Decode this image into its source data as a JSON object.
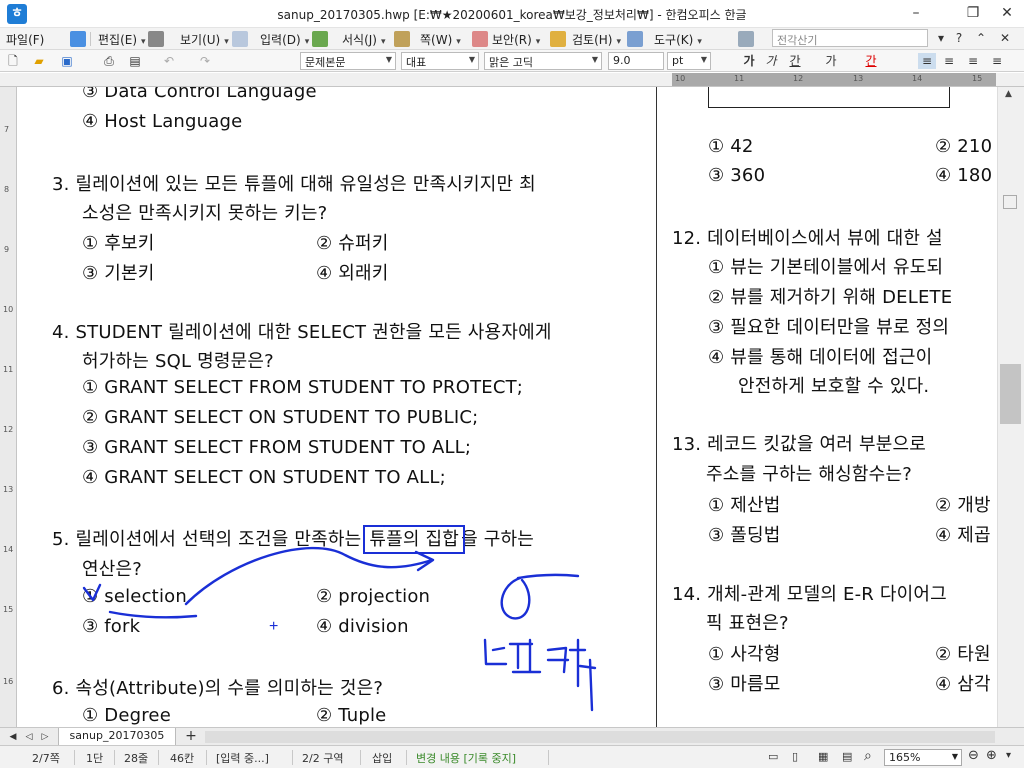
{
  "window": {
    "title": "sanup_20170305.hwp [E:₩★20200601_korea₩보강_정보처리₩] - 한컴오피스 한글",
    "minimize": "–",
    "maximize": "❐",
    "close": "✕"
  },
  "menu": {
    "items": [
      "파일(F)",
      "편집(E)",
      "보기(U)",
      "입력(D)",
      "서식(J)",
      "쪽(W)",
      "보안(R)",
      "검토(H)",
      "도구(K)"
    ],
    "search_placeholder": "전각산기"
  },
  "toolbar": {
    "style": "문제본문",
    "shape": "대표",
    "font": "맑은 고딕",
    "size": "9.0",
    "unit": "pt",
    "bold": "가",
    "italic": "가",
    "underline": "간",
    "strike": "가",
    "color": "간"
  },
  "ruler": {
    "h_numbers": [
      "10",
      "11",
      "12",
      "13",
      "14",
      "15"
    ],
    "v_numbers": [
      "7",
      "8",
      "9",
      "10",
      "11",
      "12",
      "13",
      "14",
      "15",
      "16"
    ]
  },
  "left_column": {
    "partial_top": "③  Data  Control  Language",
    "q2_opt4": "④  Host  Language",
    "q3_line1": "3.  릴레이션에  있는  모든  튜플에  대해  유일성은  만족시키지만  최",
    "q3_line2": "소성은  만족시키지  못하는  키는?",
    "q3_o1": "①  후보키",
    "q3_o2": "②  슈퍼키",
    "q3_o3": "③  기본키",
    "q3_o4": "④  외래키",
    "q4_line1": "4.  STUDENT  릴레이션에  대한  SELECT  권한을  모든  사용자에게",
    "q4_line2": "허가하는  SQL  명령문은?",
    "q4_o1": "①  GRANT  SELECT  FROM  STUDENT  TO  PROTECT;",
    "q4_o2": "②  GRANT  SELECT  ON  STUDENT  TO  PUBLIC;",
    "q4_o3": "③  GRANT  SELECT  FROM  STUDENT  TO  ALL;",
    "q4_o4": "④  GRANT  SELECT  ON  STUDENT  TO  ALL;",
    "q5_pre": "5.  릴레이션에서  선택의  조건을  만족하는 ",
    "q5_box": "튜플의  집합",
    "q5_post": "을  구하는",
    "q5_line2": "연산은?",
    "q5_o1": "①  selection",
    "q5_o2": "②  projection",
    "q5_o3": "③  fork",
    "q5_o4": "④  division",
    "q6_line1": "6.  속성(Attribute)의  수를  의미하는  것은?",
    "q6_o1": "①  Degree",
    "q6_o2": "②  Tuple"
  },
  "right_column": {
    "r_o1": "①  42",
    "r_o2": "②  210",
    "r_o3": "③  360",
    "r_o4": "④  180",
    "q12_line1": "12.  데이터베이스에서  뷰에  대한  설",
    "q12_o1": "①  뷰는  기본테이블에서  유도되",
    "q12_o2": "②  뷰를  제거하기  위해  DELETE",
    "q12_o3": "③  필요한  데이터만을  뷰로  정의",
    "q12_o4": "④  뷰를  통해  데이터에  접근이",
    "q12_o4b": "안전하게  보호할  수  있다.",
    "q13_line1": "13.  레코드  킷값을  여러  부분으로",
    "q13_line2": "주소를  구하는  해싱함수는?",
    "q13_o1": "①  제산법",
    "q13_o2": "②  개방",
    "q13_o3": "③  폴딩법",
    "q13_o4": "④  제곱",
    "q14_line1": "14.  개체-관계  모델의  E-R  다이어그",
    "q14_line2": "픽  표현은?",
    "q14_o1": "①  사각형",
    "q14_o2": "②  타원",
    "q14_o3": "③  마름모",
    "q14_o4": "④  삼각"
  },
  "tabs": {
    "doc_tab": "sanup_20170305",
    "add": "+"
  },
  "status": {
    "page": "2/7쪽",
    "section": "1단",
    "line": "28줄",
    "col": "46칸",
    "input": "[입력 중...]",
    "region": "2/2 구역",
    "mode": "삽입",
    "track": "변경 내용 [기록 중지]",
    "zoom": "165%"
  },
  "colors": {
    "ink": "#1a2fd6",
    "highlight_box": "#1a2fd6",
    "track_text": "#3a8a2a"
  }
}
